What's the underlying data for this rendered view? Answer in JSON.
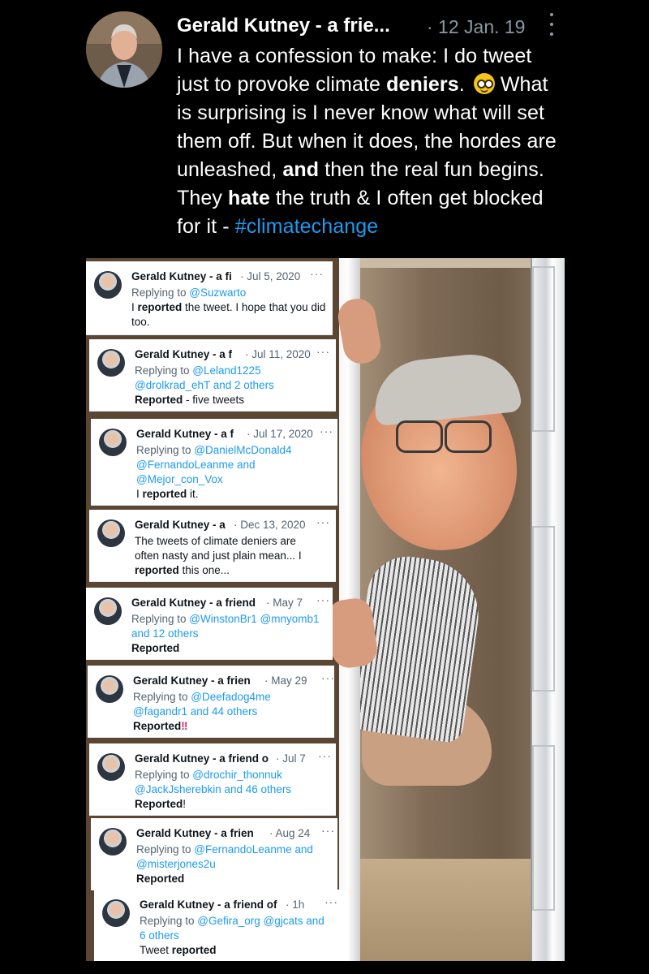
{
  "tweet": {
    "author": "Gerald Kutney - a frie...",
    "date": "· 12 Jan. 19",
    "text": {
      "p1": "I have a confession to make: I do tweet just to provoke climate ",
      "b1": "deniers",
      "p2": ". ",
      "p3": " What is surprising is I never know what will set them off. But when it does, the hordes are unleashed, ",
      "b2": "and",
      "p4": " then the real fun begins. They ",
      "b3": "hate",
      "p5": " the truth & I often get blocked for it - ",
      "hashtag": "#climatechange"
    },
    "emoji": "nerd-face-icon"
  },
  "replies": [
    {
      "name": "Gerald Kutney - a fi",
      "date": "· Jul 5, 2020",
      "more": "···",
      "replying_prefix": "Replying to ",
      "replying_handles": "@Suzwarto",
      "replying_suffix": "",
      "line2": "",
      "text_pre": "I ",
      "text_bold": "reported",
      "text_post": " the tweet. I hope that you did too."
    },
    {
      "name": "Gerald Kutney - a f",
      "date": "· Jul 11, 2020",
      "more": "···",
      "replying_prefix": "Replying to ",
      "replying_handles": "@Leland1225",
      "line2": "@drolkrad_ehT and 2 others",
      "text_pre": "",
      "text_bold": "Reported",
      "text_post": " - five tweets"
    },
    {
      "name": "Gerald Kutney - a f",
      "date": "· Jul 17, 2020",
      "more": "···",
      "replying_prefix": "Replying to ",
      "replying_handles": "@DanielMcDonald4",
      "line2": "@FernandoLeanme and",
      "line3": "@Mejor_con_Vox",
      "text_pre": "I ",
      "text_bold": "reported",
      "text_post": " it."
    },
    {
      "name": "Gerald Kutney - a",
      "date": "· Dec 13, 2020",
      "more": "···",
      "line1": "The tweets of climate deniers are",
      "line2": "often nasty and just plain mean... I",
      "text_bold": "reported",
      "text_post": " this one..."
    },
    {
      "name": "Gerald Kutney - a friend",
      "date": "· May 7",
      "more": "···",
      "replying_prefix": "Replying to ",
      "replying_handles": "@WinstonBr1 @mnyomb1",
      "line2": "and 12 others",
      "text_bold": "Reported"
    },
    {
      "name": "Gerald Kutney - a frien",
      "date": "· May 29",
      "more": "···",
      "replying_prefix": "Replying to ",
      "replying_handles": "@Deefadog4me",
      "line2": "@fagandr1 and 44 others",
      "text_bold": "Reported",
      "exclaim": "‼"
    },
    {
      "name": "Gerald Kutney - a friend o",
      "date": "· Jul 7",
      "more": "···",
      "replying_prefix": "Replying to ",
      "replying_handles": "@drochir_thonnuk",
      "line2": "@JackJsherebkin and 46 others",
      "text_bold": "Reported",
      "text_post": "!"
    },
    {
      "name": "Gerald Kutney - a frien",
      "date": "· Aug 24",
      "more": "···",
      "replying_prefix": "Replying to ",
      "replying_handles": "@FernandoLeanme and",
      "line2": "@misterjones2u",
      "text_bold": "Reported"
    },
    {
      "name": "Gerald Kutney - a friend of",
      "date": "· 1h",
      "more": "···",
      "replying_prefix": "Replying to ",
      "replying_handles": "@Gefira_org @gjcats and",
      "line2": "6 others",
      "text_pre": "Tweet ",
      "text_bold": "reported"
    }
  ],
  "colors": {
    "background": "#000000",
    "link": "#1d9bf0",
    "muted": "#8b98a5",
    "reply_muted": "#536471",
    "exclaim": "#e0245e"
  }
}
